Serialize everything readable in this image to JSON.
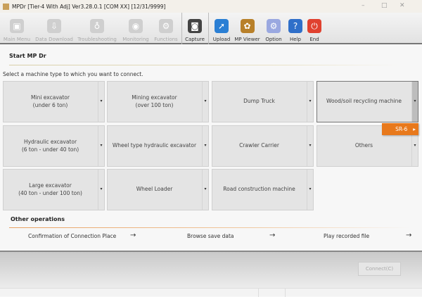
{
  "window": {
    "title": "MPDr [Tier-4 With Adj] Ver3.28.0.1 [COM XX] [12/31/9999]",
    "minimize": "–",
    "maximize": "□",
    "close": "✕"
  },
  "toolbar": [
    {
      "label": "Main Menu",
      "icon": "main-menu-icon",
      "glyph": "▣",
      "enabled": false
    },
    {
      "label": "Data Download",
      "icon": "data-download-icon",
      "glyph": "⇩",
      "enabled": false
    },
    {
      "label": "Troubleshooting",
      "icon": "stethoscope-icon",
      "glyph": "♁",
      "enabled": false
    },
    {
      "label": "Monitoring",
      "icon": "monitoring-icon",
      "glyph": "◉",
      "enabled": false
    },
    {
      "label": "Functions",
      "icon": "functions-icon",
      "glyph": "⚙",
      "enabled": false
    },
    {
      "label": "Capture",
      "icon": "camera-icon",
      "glyph": "◙",
      "enabled": true,
      "color": "#444"
    },
    {
      "label": "Upload",
      "icon": "upload-icon",
      "glyph": "➚",
      "enabled": true,
      "color": "#2a7fd4"
    },
    {
      "label": "MP Viewer",
      "icon": "mp-viewer-icon",
      "glyph": "✿",
      "enabled": true,
      "color": "#b8802a"
    },
    {
      "label": "Option",
      "icon": "option-icon",
      "glyph": "⚙",
      "enabled": true,
      "color": "#9aa8e0"
    },
    {
      "label": "Help",
      "icon": "help-icon",
      "glyph": "?",
      "enabled": true,
      "color": "#2f6fc9"
    },
    {
      "label": "End",
      "icon": "power-icon",
      "glyph": "⏻",
      "enabled": true,
      "color": "#e0412f"
    }
  ],
  "start": {
    "heading": "Start MP Dr",
    "instruction": "Select a machine type to which you want to connect."
  },
  "machines": [
    {
      "l1": "Mini excavator",
      "l2": "(under 6 ton)"
    },
    {
      "l1": "Mining excavator",
      "l2": "(over 100 ton)"
    },
    {
      "l1": "Dump Truck",
      "l2": ""
    },
    {
      "l1": "Wood/soil recycling machine",
      "l2": "",
      "selected": true
    },
    {
      "l1": "Hydraulic excavator",
      "l2": "(6 ton - under 40 ton)"
    },
    {
      "l1": "Wheel type hydraulic excavator",
      "l2": ""
    },
    {
      "l1": "Crawler Carrier",
      "l2": ""
    },
    {
      "l1": "Others",
      "l2": ""
    },
    {
      "l1": "Large excavator",
      "l2": "(40 ton - under 100 ton)"
    },
    {
      "l1": "Wheel Loader",
      "l2": ""
    },
    {
      "l1": "Road construction machine",
      "l2": ""
    }
  ],
  "dropdown_arrow": "▾",
  "popup": {
    "item": "SR-6",
    "arrow": "▸"
  },
  "other": {
    "heading": "Other operations",
    "links": [
      "Confirmation of Connection Place",
      "Browse save data",
      "Play recorded file"
    ],
    "arrow": "→"
  },
  "connect_label": "Connect(C)",
  "colors": {
    "accent": "#e8791c"
  }
}
